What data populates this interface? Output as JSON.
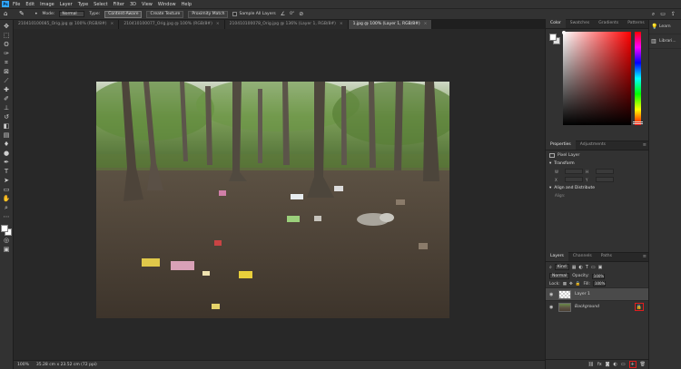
{
  "app": {
    "logo": "Ps"
  },
  "menu": [
    "File",
    "Edit",
    "Image",
    "Layer",
    "Type",
    "Select",
    "Filter",
    "3D",
    "View",
    "Window",
    "Help"
  ],
  "options_bar": {
    "mode_label": "Mode:",
    "mode_value": "Normal",
    "type_label": "Type:",
    "type_buttons": [
      "Content-Aware",
      "Create Texture",
      "Proximity Match"
    ],
    "sample_all_layers": "Sample All Layers",
    "angle_value": "0°"
  },
  "doc_tabs": [
    {
      "label": "210410100085_Orig.jpg @ 100% (RGB/8#)",
      "active": false
    },
    {
      "label": "210410100077_Orig.jpg @ 100% (RGB/8#)",
      "active": false
    },
    {
      "label": "210410100078_Orig.jpg @ 136% (Layer 1, RGB/8#)",
      "active": false
    },
    {
      "label": "1.jpg @ 100% (Layer 1, RGB/8#)",
      "active": true
    }
  ],
  "status_bar": {
    "zoom": "100%",
    "doc_info": "35.28 cm x 23.52 cm (72 ppi)"
  },
  "color_panel": {
    "tabs": [
      "Color",
      "Swatches",
      "Gradients",
      "Patterns"
    ],
    "active": "Color",
    "accent_hue": "#ff0000"
  },
  "properties_panel": {
    "tabs": [
      "Properties",
      "Adjustments"
    ],
    "active": "Properties",
    "layer_type": "Pixel Layer",
    "transform_title": "Transform",
    "transform_labels": [
      "W",
      "H",
      "X",
      "Y"
    ],
    "align_title": "Align and Distribute",
    "align_label": "Align:"
  },
  "layers_panel": {
    "tabs": [
      "Layers",
      "Channels",
      "Paths"
    ],
    "active": "Layers",
    "filter_label": "Kind",
    "blend_mode": "Normal",
    "opacity_label": "Opacity:",
    "opacity_value": "100%",
    "lock_label": "Lock:",
    "fill_label": "Fill:",
    "fill_value": "100%",
    "layers": [
      {
        "name": "Layer 1",
        "selected": true,
        "thumb": "checker"
      },
      {
        "name": "Background",
        "selected": false,
        "thumb": "photo",
        "locked": true
      }
    ],
    "highlight_color": "#e01e1e"
  },
  "far_right_panel": {
    "items": [
      {
        "label": "Learn",
        "icon": "lightbulb-icon"
      },
      {
        "label": "Librari...",
        "icon": "library-icon"
      }
    ]
  }
}
